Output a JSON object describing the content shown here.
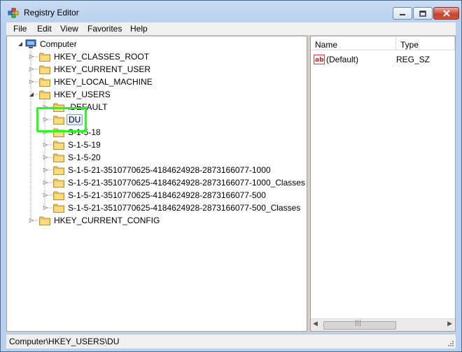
{
  "window": {
    "title": "Registry Editor"
  },
  "menu": [
    "File",
    "Edit",
    "View",
    "Favorites",
    "Help"
  ],
  "tree": {
    "root": "Computer",
    "hives": [
      "HKEY_CLASSES_ROOT",
      "HKEY_CURRENT_USER",
      "HKEY_LOCAL_MACHINE",
      "HKEY_USERS",
      "HKEY_CURRENT_CONFIG"
    ],
    "users_children": [
      ".DEFAULT",
      "DU",
      "S-1-5-18",
      "S-1-5-19",
      "S-1-5-20",
      "S-1-5-21-3510770625-4184624928-2873166077-1000",
      "S-1-5-21-3510770625-4184624928-2873166077-1000_Classes",
      "S-1-5-21-3510770625-4184624928-2873166077-500",
      "S-1-5-21-3510770625-4184624928-2873166077-500_Classes"
    ],
    "selected": "DU"
  },
  "values": {
    "columns": [
      "Name",
      "Type"
    ],
    "rows": [
      {
        "name": "(Default)",
        "type": "REG_SZ",
        "icon": "string-value-icon"
      }
    ]
  },
  "status": {
    "path": "Computer\\HKEY_USERS\\DU"
  }
}
